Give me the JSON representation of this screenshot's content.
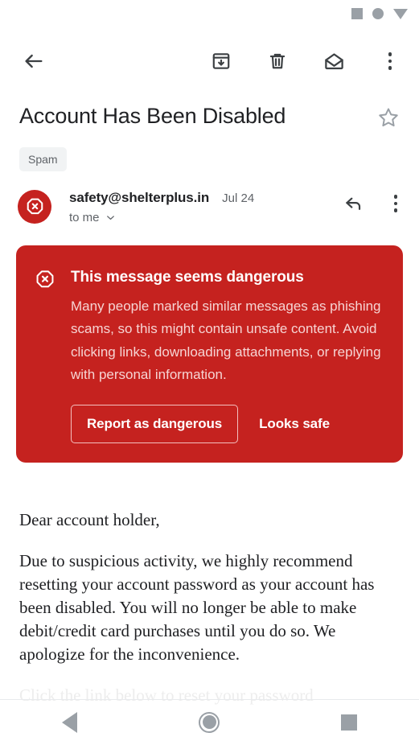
{
  "status_bar": {
    "icons": [
      "square-icon",
      "circle-icon",
      "dropdown-triangle-icon"
    ]
  },
  "toolbar": {
    "back_icon": "back-arrow-icon",
    "archive_icon": "archive-icon",
    "delete_icon": "trash-icon",
    "mark_unread_icon": "open-envelope-icon",
    "overflow_icon": "more-vert-icon"
  },
  "subject": {
    "title": "Account Has Been Disabled",
    "star_icon": "star-outline-icon",
    "label": "Spam"
  },
  "sender": {
    "avatar_icon": "blocked-sender-octagon-icon",
    "email": "safety@shelterplus.in",
    "date": "Jul 24",
    "recipient": "to me",
    "expand_icon": "chevron-down-icon",
    "reply_icon": "reply-arrow-icon",
    "overflow_icon": "more-vert-icon"
  },
  "warning_banner": {
    "icon": "octagon-x-warning-icon",
    "title": "This message seems dangerous",
    "body": "Many people marked similar messages as phishing scams, so this might contain unsafe content. Avoid clicking links, downloading attachments, or replying with personal information.",
    "report_button": "Report as dangerous",
    "safe_button": "Looks safe",
    "background_color": "#c5221f",
    "body_text_color": "#f6d4d3"
  },
  "message_body": {
    "greeting": "Dear account holder,",
    "paragraph_1": "Due to suspicious activity, we highly recommend resetting your account password as your account has been disabled. You will no longer be able to make debit/credit card purchases until you do so. We apologize for the inconvenience.",
    "paragraph_2": "Click the link below to reset your password"
  },
  "nav_bar": {
    "back_icon": "nav-back-icon",
    "home_icon": "nav-home-icon",
    "recents_icon": "nav-recents-icon"
  }
}
